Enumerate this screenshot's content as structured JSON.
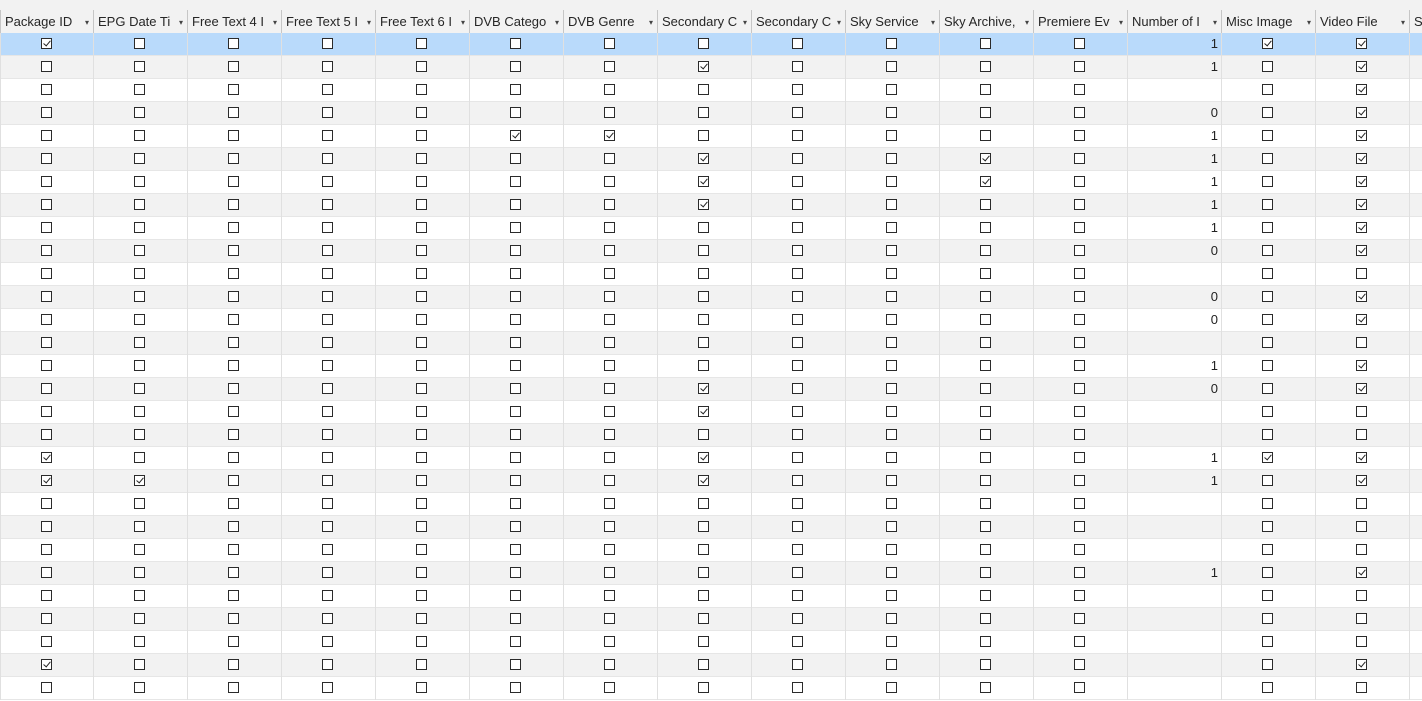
{
  "table": {
    "columns": [
      {
        "label": "Package ID",
        "type": "check"
      },
      {
        "label": "EPG Date Ti",
        "type": "check"
      },
      {
        "label": "Free Text 4 I",
        "type": "check"
      },
      {
        "label": "Free Text 5 I",
        "type": "check"
      },
      {
        "label": "Free Text 6 I",
        "type": "check"
      },
      {
        "label": "DVB Catego",
        "type": "check"
      },
      {
        "label": "DVB Genre",
        "type": "check"
      },
      {
        "label": "Secondary C",
        "type": "check"
      },
      {
        "label": "Secondary C",
        "type": "check"
      },
      {
        "label": "Sky Service",
        "type": "check"
      },
      {
        "label": "Sky Archive,",
        "type": "check"
      },
      {
        "label": "Premiere Ev",
        "type": "check"
      },
      {
        "label": "Number of I",
        "type": "number"
      },
      {
        "label": "Misc Image",
        "type": "check"
      },
      {
        "label": "Video File",
        "type": "check"
      },
      {
        "label": "Se",
        "type": "filler"
      }
    ],
    "selected_row": 0,
    "rows": [
      {
        "c": [
          1,
          0,
          0,
          0,
          0,
          0,
          0,
          0,
          0,
          0,
          0,
          0,
          0,
          1
        ],
        "n": "1",
        "v": 1
      },
      {
        "c": [
          0,
          0,
          0,
          0,
          0,
          0,
          0,
          1,
          0,
          0,
          0,
          0,
          0,
          0
        ],
        "n": "1",
        "v": 1
      },
      {
        "c": [
          0,
          0,
          0,
          0,
          0,
          0,
          0,
          0,
          0,
          0,
          0,
          0,
          0,
          0
        ],
        "n": "",
        "v": 1
      },
      {
        "c": [
          0,
          0,
          0,
          0,
          0,
          0,
          0,
          0,
          0,
          0,
          0,
          0,
          0,
          0
        ],
        "n": "0",
        "v": 1
      },
      {
        "c": [
          0,
          0,
          0,
          0,
          0,
          1,
          1,
          0,
          0,
          0,
          0,
          0,
          0,
          0
        ],
        "n": "1",
        "v": 1
      },
      {
        "c": [
          0,
          0,
          0,
          0,
          0,
          0,
          0,
          1,
          0,
          0,
          1,
          0,
          0,
          0
        ],
        "n": "1",
        "v": 1
      },
      {
        "c": [
          0,
          0,
          0,
          0,
          0,
          0,
          0,
          1,
          0,
          0,
          1,
          0,
          0,
          0
        ],
        "n": "1",
        "v": 1
      },
      {
        "c": [
          0,
          0,
          0,
          0,
          0,
          0,
          0,
          1,
          0,
          0,
          0,
          0,
          0,
          0
        ],
        "n": "1",
        "v": 1
      },
      {
        "c": [
          0,
          0,
          0,
          0,
          0,
          0,
          0,
          0,
          0,
          0,
          0,
          0,
          0,
          0
        ],
        "n": "1",
        "v": 1
      },
      {
        "c": [
          0,
          0,
          0,
          0,
          0,
          0,
          0,
          0,
          0,
          0,
          0,
          0,
          0,
          0
        ],
        "n": "0",
        "v": 1
      },
      {
        "c": [
          0,
          0,
          0,
          0,
          0,
          0,
          0,
          0,
          0,
          0,
          0,
          0,
          0,
          0
        ],
        "n": "",
        "v": 0
      },
      {
        "c": [
          0,
          0,
          0,
          0,
          0,
          0,
          0,
          0,
          0,
          0,
          0,
          0,
          0,
          0
        ],
        "n": "0",
        "v": 1
      },
      {
        "c": [
          0,
          0,
          0,
          0,
          0,
          0,
          0,
          0,
          0,
          0,
          0,
          0,
          0,
          0
        ],
        "n": "0",
        "v": 1
      },
      {
        "c": [
          0,
          0,
          0,
          0,
          0,
          0,
          0,
          0,
          0,
          0,
          0,
          0,
          0,
          0
        ],
        "n": "",
        "v": 0
      },
      {
        "c": [
          0,
          0,
          0,
          0,
          0,
          0,
          0,
          0,
          0,
          0,
          0,
          0,
          0,
          0
        ],
        "n": "1",
        "v": 1
      },
      {
        "c": [
          0,
          0,
          0,
          0,
          0,
          0,
          0,
          1,
          0,
          0,
          0,
          0,
          0,
          0
        ],
        "n": "0",
        "v": 1
      },
      {
        "c": [
          0,
          0,
          0,
          0,
          0,
          0,
          0,
          1,
          0,
          0,
          0,
          0,
          0,
          0
        ],
        "n": "",
        "v": 0
      },
      {
        "c": [
          0,
          0,
          0,
          0,
          0,
          0,
          0,
          0,
          0,
          0,
          0,
          0,
          0,
          0
        ],
        "n": "",
        "v": 0
      },
      {
        "c": [
          1,
          0,
          0,
          0,
          0,
          0,
          0,
          1,
          0,
          0,
          0,
          0,
          0,
          1
        ],
        "n": "1",
        "v": 1
      },
      {
        "c": [
          1,
          1,
          0,
          0,
          0,
          0,
          0,
          1,
          0,
          0,
          0,
          0,
          0,
          0
        ],
        "n": "1",
        "v": 1
      },
      {
        "c": [
          0,
          0,
          0,
          0,
          0,
          0,
          0,
          0,
          0,
          0,
          0,
          0,
          0,
          0
        ],
        "n": "",
        "v": 0
      },
      {
        "c": [
          0,
          0,
          0,
          0,
          0,
          0,
          0,
          0,
          0,
          0,
          0,
          0,
          0,
          0
        ],
        "n": "",
        "v": 0
      },
      {
        "c": [
          0,
          0,
          0,
          0,
          0,
          0,
          0,
          0,
          0,
          0,
          0,
          0,
          0,
          0
        ],
        "n": "",
        "v": 0
      },
      {
        "c": [
          0,
          0,
          0,
          0,
          0,
          0,
          0,
          0,
          0,
          0,
          0,
          0,
          0,
          0
        ],
        "n": "1",
        "v": 1
      },
      {
        "c": [
          0,
          0,
          0,
          0,
          0,
          0,
          0,
          0,
          0,
          0,
          0,
          0,
          0,
          0
        ],
        "n": "",
        "v": 0
      },
      {
        "c": [
          0,
          0,
          0,
          0,
          0,
          0,
          0,
          0,
          0,
          0,
          0,
          0,
          0,
          0
        ],
        "n": "",
        "v": 0
      },
      {
        "c": [
          0,
          0,
          0,
          0,
          0,
          0,
          0,
          0,
          0,
          0,
          0,
          0,
          0,
          0
        ],
        "n": "",
        "v": 0
      },
      {
        "c": [
          1,
          0,
          0,
          0,
          0,
          0,
          0,
          0,
          0,
          0,
          0,
          0,
          0,
          0
        ],
        "n": "",
        "v": 1
      },
      {
        "c": [
          0,
          0,
          0,
          0,
          0,
          0,
          0,
          0,
          0,
          0,
          0,
          0,
          0,
          0
        ],
        "n": "",
        "v": 0
      }
    ]
  },
  "colors": {
    "header_bg": "#f2f2f2",
    "selected_row": "#b9dafb",
    "alt_row": "#f2f2f2",
    "grid_line": "#e0e0e0"
  },
  "icons": {
    "dropdown": "filter-dropdown-arrow-icon",
    "check": "checkbox-check-icon"
  }
}
